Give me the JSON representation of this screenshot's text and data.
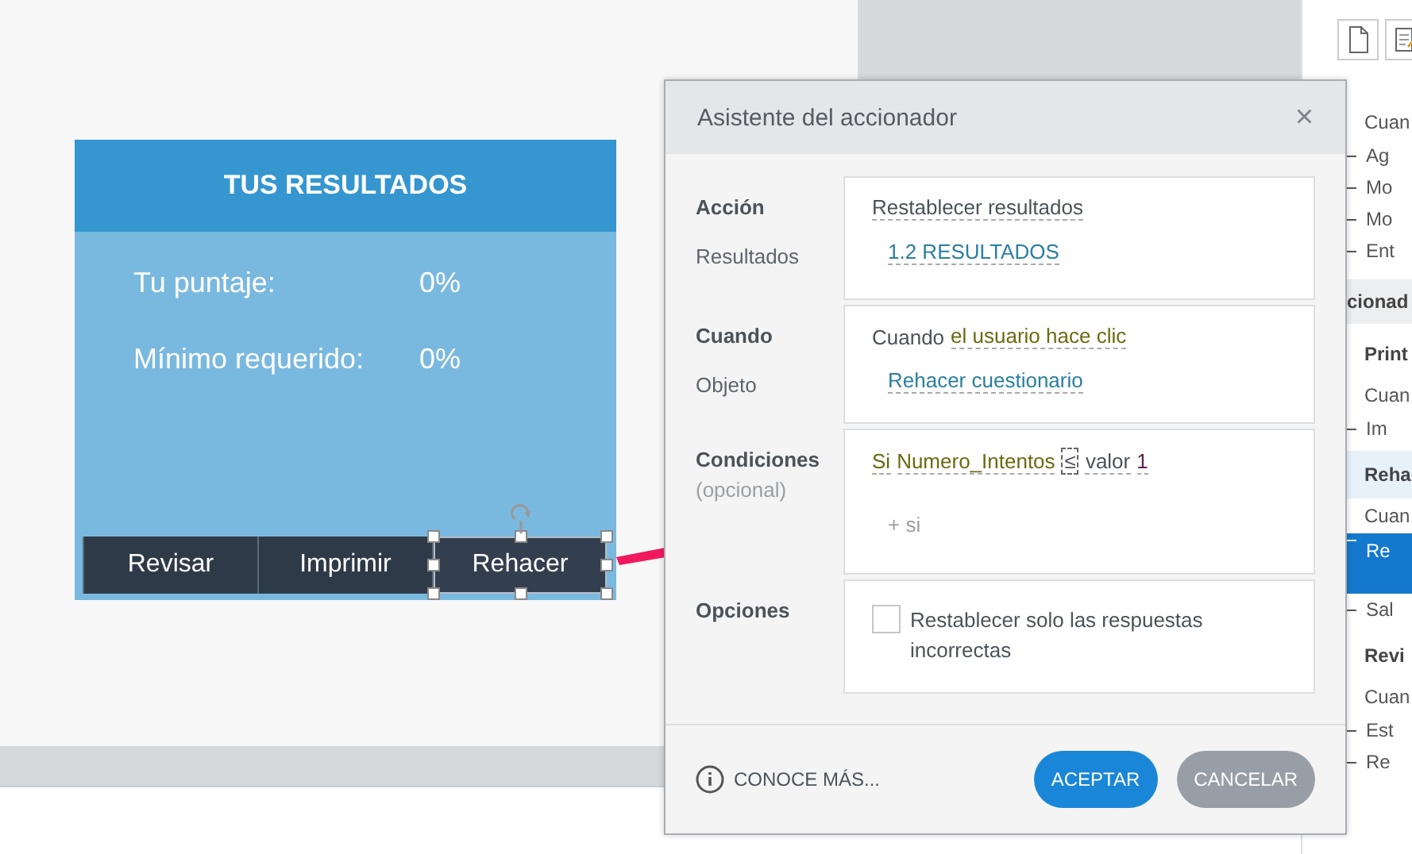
{
  "quiz": {
    "title": "TUS RESULTADOS",
    "rows": [
      {
        "label": "Tu puntaje:",
        "value": "0%"
      },
      {
        "label": "Mínimo requerido:",
        "value": "0%"
      }
    ],
    "buttons": [
      {
        "label": "Revisar",
        "selected": false
      },
      {
        "label": "Imprimir",
        "selected": false
      },
      {
        "label": "Rehacer",
        "selected": true
      }
    ]
  },
  "dialog": {
    "title": "Asistente del accionador",
    "close": "×",
    "sections": [
      {
        "title": "Acción",
        "caption": {
          "text": "Resultados",
          "kind": "field"
        },
        "lines": [
          {
            "kind": "phrase",
            "parts": [
              {
                "text": "Restablecer resultados",
                "kind": "choice"
              }
            ]
          },
          {
            "kind": "phrase",
            "parts": [
              {
                "text": "1.2 RESULTADOS",
                "kind": "link"
              }
            ]
          }
        ]
      },
      {
        "title": "Cuando",
        "caption": {
          "text": "Objeto",
          "kind": "field"
        },
        "lines": [
          {
            "kind": "phrase",
            "parts": [
              {
                "text": "Cuando",
                "kind": "plain"
              },
              {
                "text": "el usuario hace clic",
                "kind": "event"
              }
            ]
          },
          {
            "kind": "phrase",
            "parts": [
              {
                "text": "Rehacer cuestionario",
                "kind": "link"
              }
            ]
          }
        ]
      },
      {
        "title": "Condiciones",
        "caption": {
          "text": "(opcional)",
          "kind": "note"
        },
        "lines": [
          {
            "kind": "phrase",
            "parts": [
              {
                "text": "Si",
                "kind": "event"
              },
              {
                "text": "Numero_Intentos",
                "kind": "event"
              },
              {
                "text": "≤",
                "kind": "operator"
              },
              {
                "text": "valor",
                "kind": "choice"
              },
              {
                "text": "1",
                "kind": "number"
              }
            ]
          },
          {
            "kind": "add",
            "text": "+ si"
          }
        ]
      },
      {
        "title": "Opciones",
        "lines": [
          {
            "kind": "checkbox",
            "text": "Restablecer solo las respuestas incorrectas",
            "checked": false
          }
        ]
      }
    ],
    "footer": {
      "learn_more": "CONOCE MÁS...",
      "buttons": [
        {
          "label": "ACEPTAR",
          "kind": "primary"
        },
        {
          "label": "CANCELAR",
          "kind": "secondary"
        }
      ]
    }
  },
  "side_panel": {
    "items": [
      {
        "text": "Cuan",
        "kind": "trigger",
        "selected": false
      },
      {
        "text": "Ag",
        "kind": "action",
        "selected": false
      },
      {
        "text": "Mo",
        "kind": "action",
        "selected": false
      },
      {
        "text": "Mo",
        "kind": "action",
        "selected": false
      },
      {
        "text": "Ent",
        "kind": "action",
        "selected": false
      },
      {
        "text": "cionad",
        "kind": "section",
        "selected": false
      },
      {
        "text": "Print",
        "kind": "group",
        "selected": false
      },
      {
        "text": "Cuan",
        "kind": "trigger",
        "selected": false
      },
      {
        "text": "Im",
        "kind": "action",
        "selected": false
      },
      {
        "text": "Reha",
        "kind": "group",
        "selected": true
      },
      {
        "text": "Cuan",
        "kind": "trigger",
        "selected": false
      },
      {
        "text": "Re",
        "kind": "action",
        "selected": true
      },
      {
        "text": "Sal",
        "kind": "action",
        "selected": false
      },
      {
        "text": "Revi",
        "kind": "group",
        "selected": false
      },
      {
        "text": "Cuan",
        "kind": "trigger",
        "selected": false
      },
      {
        "text": "Est",
        "kind": "action",
        "selected": false
      },
      {
        "text": "Re",
        "kind": "action",
        "selected": false
      }
    ]
  }
}
